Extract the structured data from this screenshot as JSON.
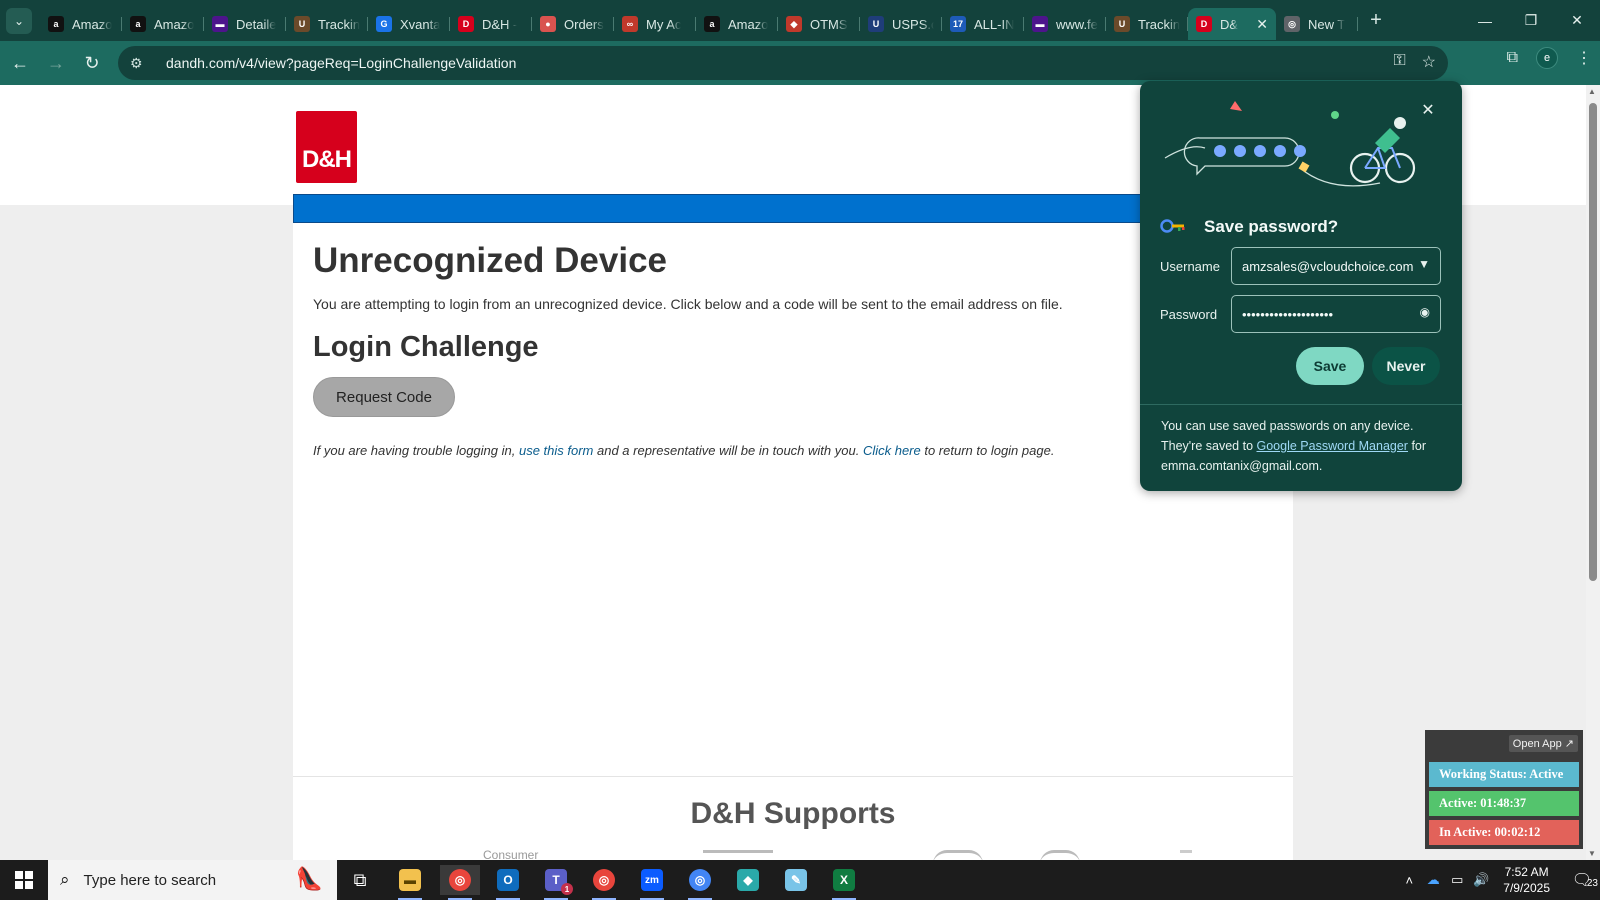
{
  "browser": {
    "tabs": [
      {
        "label": "Amazo",
        "favicon": "amazon-icon",
        "color": "#111111",
        "glyph": "a"
      },
      {
        "label": "Amazo",
        "favicon": "amazon-icon",
        "color": "#111111",
        "glyph": "a"
      },
      {
        "label": "Detaile",
        "favicon": "fedex-icon",
        "color": "#4d148c",
        "glyph": "▬"
      },
      {
        "label": "Trackin",
        "favicon": "ups-icon",
        "color": "#6b4a2a",
        "glyph": "U"
      },
      {
        "label": "Xvanta",
        "favicon": "xvantage-icon",
        "color": "#1a73e8",
        "glyph": "G"
      },
      {
        "label": "D&H -",
        "favicon": "dandh-icon",
        "color": "#d6001c",
        "glyph": "D"
      },
      {
        "label": "Orders",
        "favicon": "orders-icon",
        "color": "#d9534f",
        "glyph": "●"
      },
      {
        "label": "My Ac",
        "favicon": "myaccount-icon",
        "color": "#c0392b",
        "glyph": "∞"
      },
      {
        "label": "Amazo",
        "favicon": "amazon-icon",
        "color": "#111111",
        "glyph": "a"
      },
      {
        "label": "OTMS",
        "favicon": "otms-icon",
        "color": "#c0392b",
        "glyph": "◆"
      },
      {
        "label": "USPS.c",
        "favicon": "usps-icon",
        "color": "#1f3d7a",
        "glyph": "U"
      },
      {
        "label": "ALL-IN",
        "favicon": "allin-icon",
        "color": "#1e5bb8",
        "glyph": "17"
      },
      {
        "label": "www.fe",
        "favicon": "fedex-icon",
        "color": "#4d148c",
        "glyph": "▬"
      },
      {
        "label": "Trackin",
        "favicon": "ups-icon",
        "color": "#6b4a2a",
        "glyph": "U"
      },
      {
        "label": "D&",
        "favicon": "dandh-icon",
        "color": "#d6001c",
        "glyph": "D",
        "active": true
      },
      {
        "label": "New T",
        "favicon": "chrome-icon",
        "color": "#5f6368",
        "glyph": "◎"
      }
    ],
    "url": "dandh.com/v4/view?pageReq=LoginChallengeValidation",
    "profile_initial": "e"
  },
  "page": {
    "logo_text": "D&H",
    "heading": "Unrecognized Device",
    "description": "You are attempting to login from an unrecognized device. Click below and a code will be sent to the email address on file.",
    "challenge_heading": "Login Challenge",
    "request_button": "Request Code",
    "help_prefix": "If you are having trouble logging in, ",
    "help_link1": "use this form",
    "help_middle": " and a representative will be in touch with you. ",
    "help_link2": "Click here",
    "help_suffix": " to return to login page.",
    "supports_heading": "D&H Supports",
    "consumer_label": "Consumer"
  },
  "password_bubble": {
    "title": "Save password?",
    "username_label": "Username",
    "username_value": "amzsales@vcloudchoice.com",
    "password_label": "Password",
    "password_value": "••••••••••••••••••••",
    "save_label": "Save",
    "never_label": "Never",
    "footer_prefix": "You can use saved passwords on any device. They're saved to ",
    "footer_link": "Google Password Manager",
    "footer_middle": " for",
    "footer_account": "emma.comtanix@gmail.com."
  },
  "tracker": {
    "open_app": "Open App ↗",
    "status": "Working Status: Active",
    "active": "Active: 01:48:37",
    "inactive": "In Active: 00:02:12"
  },
  "taskbar": {
    "search_placeholder": "Type here to search",
    "time": "7:52 AM",
    "date": "7/9/2025",
    "notification_count": "23",
    "teams_badge": "1"
  }
}
